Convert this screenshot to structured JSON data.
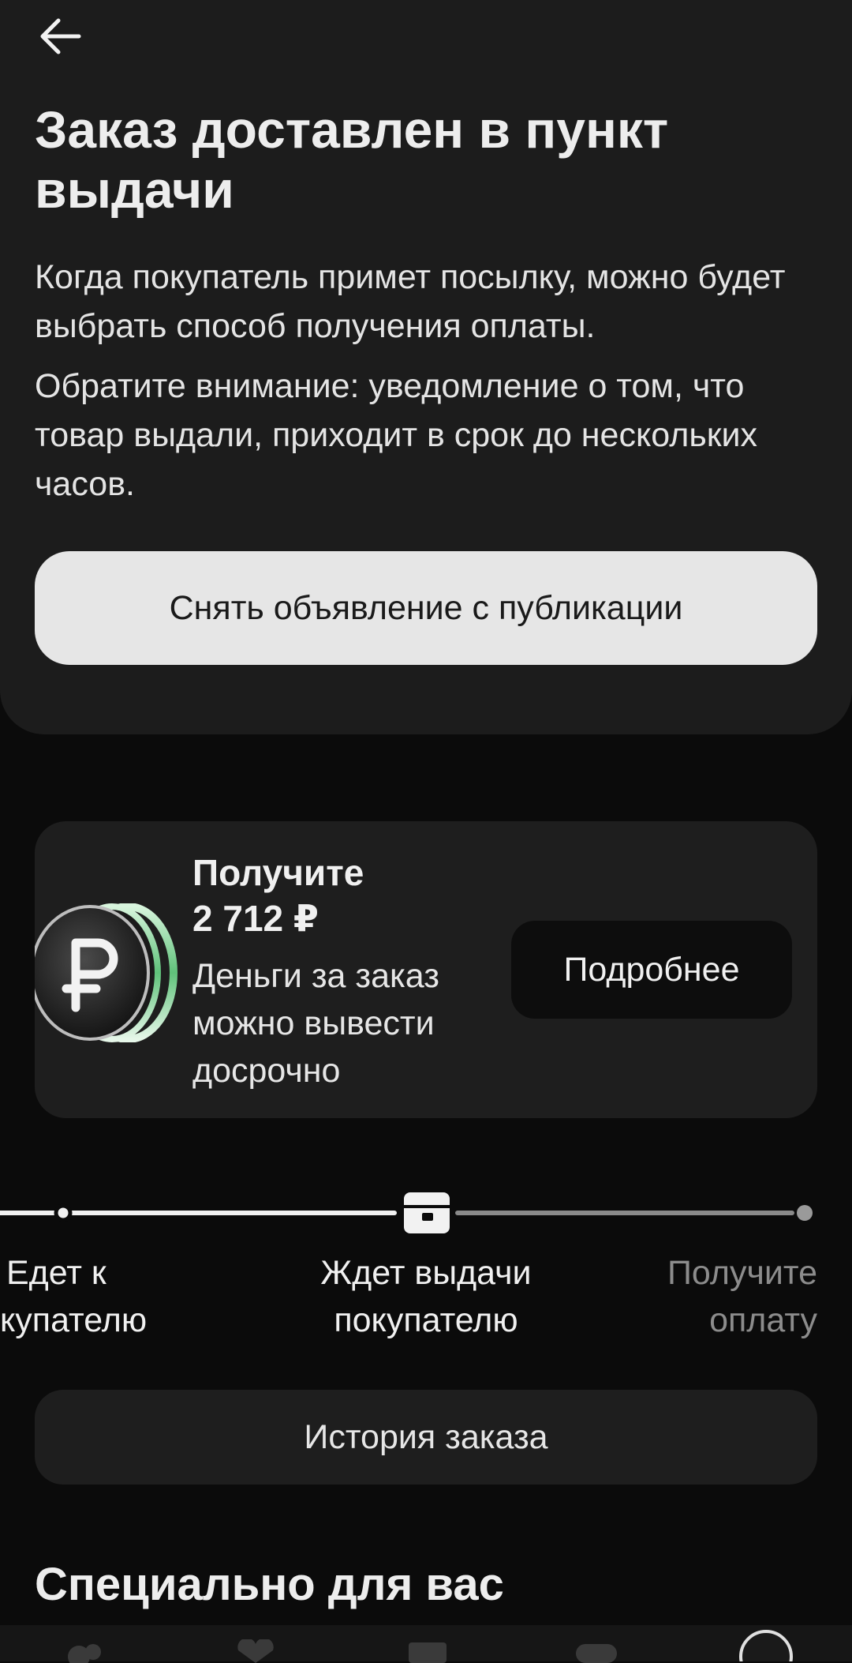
{
  "header": {
    "title": "Заказ доставлен в пункт выдачи",
    "paragraph1": "Когда покупатель примет посылку, можно будет выбрать способ получения оплаты.",
    "paragraph2": "Обратите внимание: уведомление о том, что товар выдали, приходит в срок до нескольких часов.",
    "unpublish_label": "Снять объявление с публикации",
    "back_icon": "arrow-left-icon"
  },
  "promo": {
    "title_line1": "Получите",
    "amount": "2 712 ₽",
    "description": "Деньги за заказ можно вывести досрочно",
    "button_label": "Подробнее",
    "icon": "ruble-coin-icon"
  },
  "progress": {
    "steps": [
      {
        "label_line1": "Едет к",
        "label_line2": "купателю",
        "state": "done"
      },
      {
        "label_line1": "Ждет выдачи",
        "label_line2": "покупателю",
        "state": "current"
      },
      {
        "label_line1": "Получите",
        "label_line2": "оплату",
        "state": "pending"
      }
    ]
  },
  "history_label": "История заказа",
  "section_title": "Специально для вас",
  "colors": {
    "page_bg": "#0b0b0b",
    "card_bg": "#1c1c1c",
    "accent_coin": "#6fd68a"
  }
}
